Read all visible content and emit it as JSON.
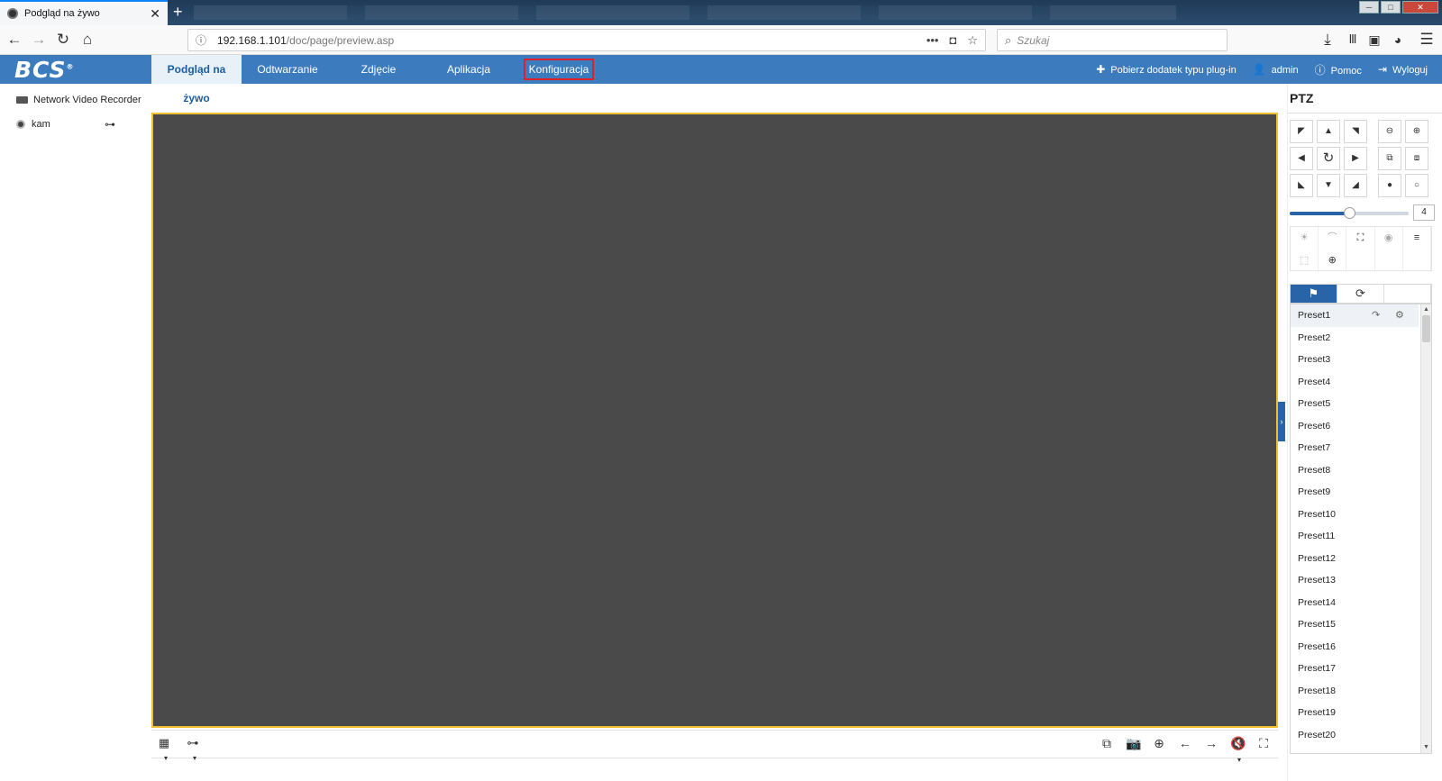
{
  "browser": {
    "tab_title": "Podgląd na żywo",
    "tab_close": "✕",
    "new_tab": "+",
    "url_host": "192.168.1.101",
    "url_path": "/doc/page/preview.asp",
    "search_placeholder": "Szukaj"
  },
  "app": {
    "logo": "BCS",
    "logo_mark": "®",
    "menu": [
      "Podgląd na żywo",
      "Odtwarzanie",
      "Zdjęcie",
      "Aplikacja",
      "Konfiguracja"
    ],
    "header_links": {
      "plugin": "Pobierz dodatek typu plug-in",
      "user": "admin",
      "help": "Pomoc",
      "logout": "Wyloguj"
    }
  },
  "device_tree": {
    "root": "Network Video Recorder",
    "camera": "kam"
  },
  "ptz": {
    "title": "PTZ",
    "speed_value": "4",
    "speed_fraction": 0.5,
    "presets": [
      "Preset1",
      "Preset2",
      "Preset3",
      "Preset4",
      "Preset5",
      "Preset6",
      "Preset7",
      "Preset8",
      "Preset9",
      "Preset10",
      "Preset11",
      "Preset12",
      "Preset13",
      "Preset14",
      "Preset15",
      "Preset16",
      "Preset17",
      "Preset18",
      "Preset19",
      "Preset20"
    ]
  },
  "colors": {
    "header_blue": "#3d7bbf",
    "active_tab_text": "#1b5ea0",
    "highlight_border": "#e0202a",
    "video_border": "#f0c030",
    "video_bg": "#4a4a4a"
  }
}
